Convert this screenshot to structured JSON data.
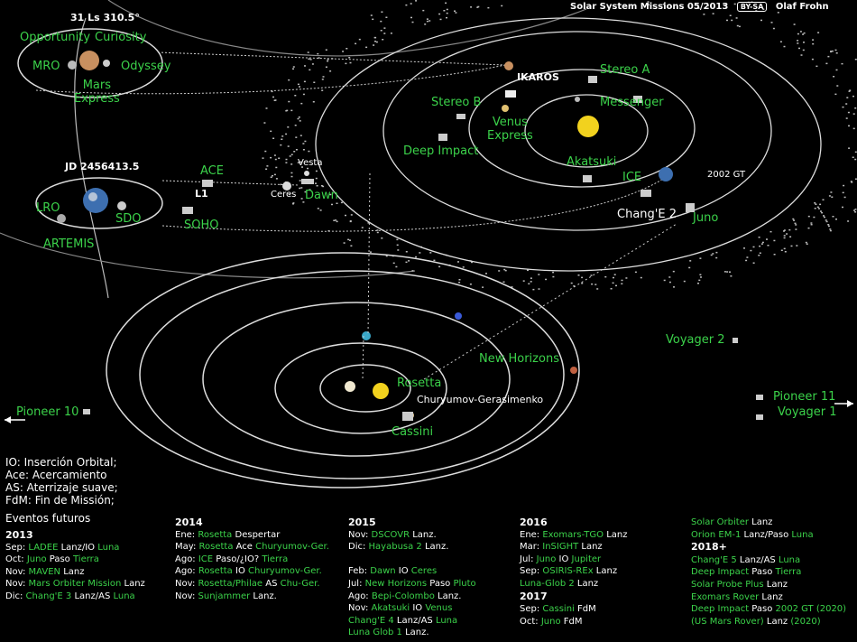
{
  "header": {
    "title": "Solar System Missions 05/2013",
    "license": "BY-SA",
    "author": "Olaf Frohn"
  },
  "mars_panel": {
    "date": "31 Ls 310.5°",
    "labels": {
      "opportunity": "Opportunity",
      "curiosity": "Curiosity",
      "mro": "MRO",
      "odyssey": "Odyssey",
      "mars_express": "Mars\nExpress"
    }
  },
  "earth_panel": {
    "date": "JD 2456413.5",
    "labels": {
      "lro": "LRO",
      "sdo": "SDO",
      "artemis": "ARTEMIS",
      "ace": "ACE",
      "l1": "L1",
      "soho": "SOHO",
      "vesta": "Vesta",
      "ceres": "Ceres",
      "dawn": "Dawn"
    }
  },
  "inner_system": {
    "labels": {
      "ikaros": "IKAROS",
      "stereo_a": "Stereo A",
      "stereo_b": "Stereo B",
      "messenger": "Messenger",
      "venus_express": "Venus\nExpress",
      "deep_impact": "Deep Impact",
      "akatsuki": "Akatsuki",
      "ice": "ICE",
      "gt2002": "2002 GT",
      "change2": "Chang'E 2",
      "juno": "Juno"
    }
  },
  "outer_system": {
    "labels": {
      "voyager2": "Voyager 2",
      "new_horizons": "New Horizons",
      "rosetta": "Rosetta",
      "churyumov": "Churyumov-Gerasimenko",
      "cassini": "Cassini",
      "pioneer10": "Pioneer 10",
      "pioneer11": "Pioneer 11",
      "voyager1": "Voyager 1"
    }
  },
  "legend": {
    "io": "IO: Inserción Orbital;",
    "ace": "Ace: Acercamiento",
    "as": "AS: Aterrizaje suave;",
    "fdm": "FdM: Fin de Missión;",
    "future": "Eventos futuros"
  },
  "events": [
    {
      "year": "2013",
      "rows": [
        [
          "Sep:",
          "LADEE",
          "Lanz/IO",
          "Luna"
        ],
        [
          "Oct:",
          "Juno",
          "Paso",
          "Tierra"
        ],
        [
          "Nov:",
          "MAVEN",
          "Lanz",
          ""
        ],
        [
          "Nov:",
          "Mars Orbiter Mission",
          "Lanz",
          ""
        ],
        [
          "Dic:",
          "Chang'E 3",
          "Lanz/AS",
          "Luna"
        ]
      ]
    },
    {
      "year": "2014",
      "rows": [
        [
          "Ene:",
          "Rosetta",
          "Despertar",
          ""
        ],
        [
          "May:",
          "Rosetta",
          "Ace",
          "Churyumov-Ger."
        ],
        [
          "Ago:",
          "ICE",
          "Paso/¿IO?",
          "Tierra"
        ],
        [
          "Ago:",
          "Rosetta",
          "IO",
          "Churyumov-Ger."
        ],
        [
          "Nov:",
          "Rosetta/Philae",
          "AS",
          "Chu-Ger."
        ],
        [
          "Nov:",
          "Sunjammer",
          "Lanz.",
          ""
        ]
      ]
    },
    {
      "year": "2015",
      "rows": [
        [
          "Nov:",
          "DSCOVR",
          "Lanz.",
          ""
        ],
        [
          "Dic:",
          "Hayabusa 2",
          "Lanz.",
          ""
        ],
        [
          "",
          "",
          "",
          ""
        ],
        [
          "Feb:",
          "Dawn",
          "IO",
          "Ceres"
        ],
        [
          "Jul:",
          "New Horizons",
          "Paso",
          "Pluto"
        ],
        [
          "Ago:",
          "Bepi-Colombo",
          "Lanz.",
          ""
        ],
        [
          "Nov:",
          "Akatsuki",
          "IO",
          "Venus"
        ],
        [
          "",
          "Chang'E 4",
          "Lanz/AS",
          "Luna"
        ],
        [
          "",
          "Luna Glob 1",
          "Lanz.",
          ""
        ]
      ]
    },
    {
      "year": "2016",
      "rows": [
        [
          "Ene:",
          "Exomars-TGO",
          "Lanz",
          ""
        ],
        [
          "Mar:",
          "InSIGHT",
          "Lanz",
          ""
        ],
        [
          "Jul:",
          "Juno",
          "IO",
          "Jupiter"
        ],
        [
          "Sep:",
          "OSIRIS-REx",
          "Lanz",
          ""
        ],
        [
          "",
          "Luna-Glob 2",
          "Lanz",
          ""
        ],
        [
          "2017",
          "",
          "",
          ""
        ],
        [
          "Sep:",
          "Cassini",
          "FdM",
          ""
        ],
        [
          "Oct:",
          "Juno",
          "FdM",
          ""
        ]
      ]
    },
    {
      "year": "",
      "rows": [
        [
          "",
          "Solar Orbiter",
          "Lanz",
          ""
        ],
        [
          "",
          "Orion EM-1",
          "Lanz/Paso",
          "Luna"
        ],
        [
          "2018+",
          "",
          "",
          ""
        ],
        [
          "",
          "Chang'E 5",
          "Lanz/AS",
          "Luna"
        ],
        [
          "",
          "Deep Impact",
          "Paso",
          "Tierra"
        ],
        [
          "",
          "Solar Probe Plus",
          "Lanz",
          ""
        ],
        [
          "",
          "Exomars Rover",
          "Lanz",
          ""
        ],
        [
          "",
          "Deep Impact",
          "Paso",
          "2002 GT (2020)"
        ],
        [
          "",
          "(US Mars Rover)",
          "Lanz",
          "(2020)"
        ]
      ]
    }
  ]
}
